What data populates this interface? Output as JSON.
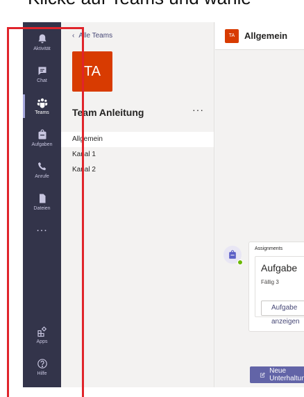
{
  "caption": "Klicke auf Teams und wähle",
  "rail": {
    "items": [
      {
        "label": "Aktivität",
        "icon": "bell-icon"
      },
      {
        "label": "Chat",
        "icon": "chat-icon"
      },
      {
        "label": "Teams",
        "icon": "teams-icon"
      },
      {
        "label": "Aufgaben",
        "icon": "backpack-icon"
      },
      {
        "label": "Anrufe",
        "icon": "phone-icon"
      },
      {
        "label": "Dateien",
        "icon": "file-icon"
      }
    ],
    "more": "...",
    "bottom": [
      {
        "label": "Apps",
        "icon": "apps-icon"
      },
      {
        "label": "Hilfe",
        "icon": "help-icon"
      }
    ]
  },
  "teams_pane": {
    "back_label": "Alle Teams",
    "avatar_text": "TA",
    "team_name": "Team Anleitung",
    "more": "···",
    "channels": [
      "Allgemein",
      "Kanal 1",
      "Kanal 2"
    ]
  },
  "main": {
    "channel_avatar": "TA",
    "channel_title": "Allgemein",
    "card_meta": "Assignments",
    "card_title": "Aufgabe",
    "card_due": "Fällig 3",
    "card_button": "Aufgabe anzeigen",
    "new_button": "Neue Unterhaltung"
  },
  "colors": {
    "rail": "#33344a",
    "brand": "#6264a7",
    "team_avatar": "#d83b01",
    "highlight": "#e0242b"
  }
}
